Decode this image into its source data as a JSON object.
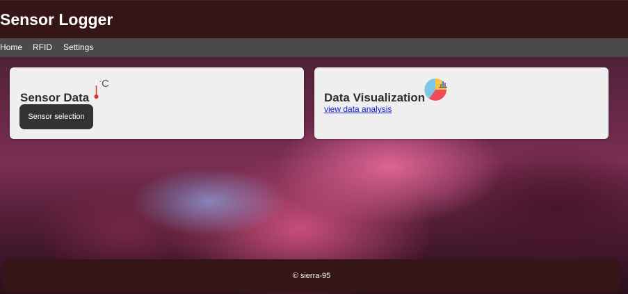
{
  "header": {
    "title": "Sensor Logger"
  },
  "nav": {
    "items": [
      "Home",
      "RFID",
      "Settings"
    ]
  },
  "cards": {
    "sensor": {
      "title": "Sensor Data",
      "icon": "thermometer-celsius-icon",
      "unit": "°C",
      "button_label": "Sensor selection"
    },
    "visualization": {
      "title": "Data Visualization",
      "icon": "pie-chart-icon",
      "link_label": "view data analysis"
    }
  },
  "footer": {
    "text": "© sierra-95"
  },
  "colors": {
    "header_bg": "#361516",
    "nav_bg": "#4a4a4a",
    "card_bg": "#efefef",
    "button_bg": "#333333",
    "link": "#1a1ad6"
  }
}
